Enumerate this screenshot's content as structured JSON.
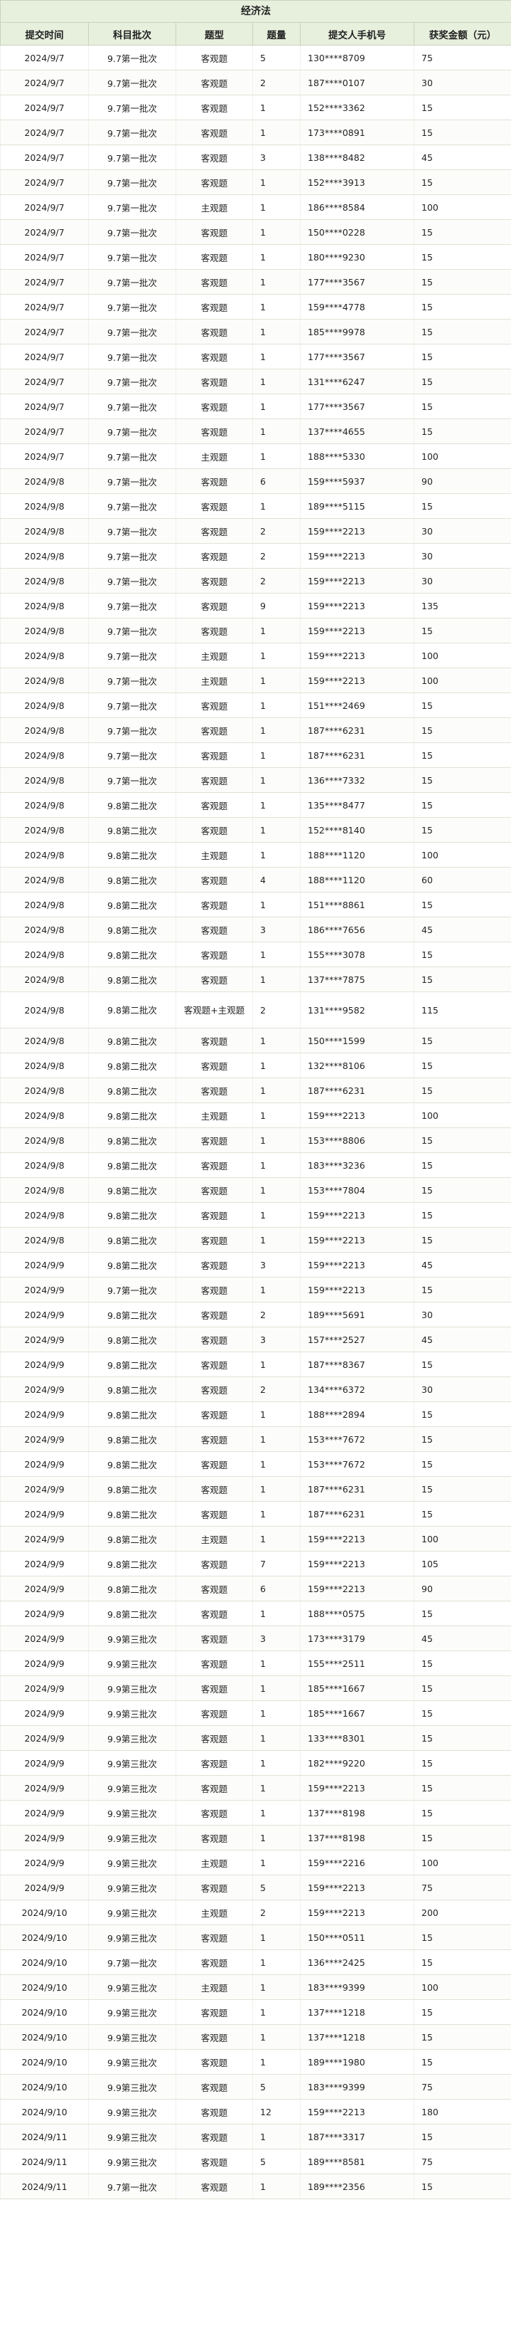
{
  "title": "经济法",
  "headers": [
    "提交时间",
    "科目批次",
    "题型",
    "题量",
    "提交人手机号",
    "获奖金额（元）"
  ],
  "rows": [
    [
      "2024/9/7",
      "9.7第一批次",
      "客观题",
      "5",
      "130****8709",
      "75"
    ],
    [
      "2024/9/7",
      "9.7第一批次",
      "客观题",
      "2",
      "187****0107",
      "30"
    ],
    [
      "2024/9/7",
      "9.7第一批次",
      "客观题",
      "1",
      "152****3362",
      "15"
    ],
    [
      "2024/9/7",
      "9.7第一批次",
      "客观题",
      "1",
      "173****0891",
      "15"
    ],
    [
      "2024/9/7",
      "9.7第一批次",
      "客观题",
      "3",
      "138****8482",
      "45"
    ],
    [
      "2024/9/7",
      "9.7第一批次",
      "客观题",
      "1",
      "152****3913",
      "15"
    ],
    [
      "2024/9/7",
      "9.7第一批次",
      "主观题",
      "1",
      "186****8584",
      "100"
    ],
    [
      "2024/9/7",
      "9.7第一批次",
      "客观题",
      "1",
      "150****0228",
      "15"
    ],
    [
      "2024/9/7",
      "9.7第一批次",
      "客观题",
      "1",
      "180****9230",
      "15"
    ],
    [
      "2024/9/7",
      "9.7第一批次",
      "客观题",
      "1",
      "177****3567",
      "15"
    ],
    [
      "2024/9/7",
      "9.7第一批次",
      "客观题",
      "1",
      "159****4778",
      "15"
    ],
    [
      "2024/9/7",
      "9.7第一批次",
      "客观题",
      "1",
      "185****9978",
      "15"
    ],
    [
      "2024/9/7",
      "9.7第一批次",
      "客观题",
      "1",
      "177****3567",
      "15"
    ],
    [
      "2024/9/7",
      "9.7第一批次",
      "客观题",
      "1",
      "131****6247",
      "15"
    ],
    [
      "2024/9/7",
      "9.7第一批次",
      "客观题",
      "1",
      "177****3567",
      "15"
    ],
    [
      "2024/9/7",
      "9.7第一批次",
      "客观题",
      "1",
      "137****4655",
      "15"
    ],
    [
      "2024/9/7",
      "9.7第一批次",
      "主观题",
      "1",
      "188****5330",
      "100"
    ],
    [
      "2024/9/8",
      "9.7第一批次",
      "客观题",
      "6",
      "159****5937",
      "90"
    ],
    [
      "2024/9/8",
      "9.7第一批次",
      "客观题",
      "1",
      "189****5115",
      "15"
    ],
    [
      "2024/9/8",
      "9.7第一批次",
      "客观题",
      "2",
      "159****2213",
      "30"
    ],
    [
      "2024/9/8",
      "9.7第一批次",
      "客观题",
      "2",
      "159****2213",
      "30"
    ],
    [
      "2024/9/8",
      "9.7第一批次",
      "客观题",
      "2",
      "159****2213",
      "30"
    ],
    [
      "2024/9/8",
      "9.7第一批次",
      "客观题",
      "9",
      "159****2213",
      "135"
    ],
    [
      "2024/9/8",
      "9.7第一批次",
      "客观题",
      "1",
      "159****2213",
      "15"
    ],
    [
      "2024/9/8",
      "9.7第一批次",
      "主观题",
      "1",
      "159****2213",
      "100"
    ],
    [
      "2024/9/8",
      "9.7第一批次",
      "主观题",
      "1",
      "159****2213",
      "100"
    ],
    [
      "2024/9/8",
      "9.7第一批次",
      "客观题",
      "1",
      "151****2469",
      "15"
    ],
    [
      "2024/9/8",
      "9.7第一批次",
      "客观题",
      "1",
      "187****6231",
      "15"
    ],
    [
      "2024/9/8",
      "9.7第一批次",
      "客观题",
      "1",
      "187****6231",
      "15"
    ],
    [
      "2024/9/8",
      "9.7第一批次",
      "客观题",
      "1",
      "136****7332",
      "15"
    ],
    [
      "2024/9/8",
      "9.8第二批次",
      "客观题",
      "1",
      "135****8477",
      "15"
    ],
    [
      "2024/9/8",
      "9.8第二批次",
      "客观题",
      "1",
      "152****8140",
      "15"
    ],
    [
      "2024/9/8",
      "9.8第二批次",
      "主观题",
      "1",
      "188****1120",
      "100"
    ],
    [
      "2024/9/8",
      "9.8第二批次",
      "客观题",
      "4",
      "188****1120",
      "60"
    ],
    [
      "2024/9/8",
      "9.8第二批次",
      "客观题",
      "1",
      "151****8861",
      "15"
    ],
    [
      "2024/9/8",
      "9.8第二批次",
      "客观题",
      "3",
      "186****7656",
      "45"
    ],
    [
      "2024/9/8",
      "9.8第二批次",
      "客观题",
      "1",
      "155****3078",
      "15"
    ],
    [
      "2024/9/8",
      "9.8第二批次",
      "客观题",
      "1",
      "137****7875",
      "15"
    ],
    [
      "2024/9/8",
      "9.8第二批次",
      "客观题+主观题",
      "2",
      "131****9582",
      "115"
    ],
    [
      "2024/9/8",
      "9.8第二批次",
      "客观题",
      "1",
      "150****1599",
      "15"
    ],
    [
      "2024/9/8",
      "9.8第二批次",
      "客观题",
      "1",
      "132****8106",
      "15"
    ],
    [
      "2024/9/8",
      "9.8第二批次",
      "客观题",
      "1",
      "187****6231",
      "15"
    ],
    [
      "2024/9/8",
      "9.8第二批次",
      "主观题",
      "1",
      "159****2213",
      "100"
    ],
    [
      "2024/9/8",
      "9.8第二批次",
      "客观题",
      "1",
      "153****8806",
      "15"
    ],
    [
      "2024/9/8",
      "9.8第二批次",
      "客观题",
      "1",
      "183****3236",
      "15"
    ],
    [
      "2024/9/8",
      "9.8第二批次",
      "客观题",
      "1",
      "153****7804",
      "15"
    ],
    [
      "2024/9/8",
      "9.8第二批次",
      "客观题",
      "1",
      "159****2213",
      "15"
    ],
    [
      "2024/9/8",
      "9.8第二批次",
      "客观题",
      "1",
      "159****2213",
      "15"
    ],
    [
      "2024/9/9",
      "9.8第二批次",
      "客观题",
      "3",
      "159****2213",
      "45"
    ],
    [
      "2024/9/9",
      "9.7第一批次",
      "客观题",
      "1",
      "159****2213",
      "15"
    ],
    [
      "2024/9/9",
      "9.8第二批次",
      "客观题",
      "2",
      "189****5691",
      "30"
    ],
    [
      "2024/9/9",
      "9.8第二批次",
      "客观题",
      "3",
      "157****2527",
      "45"
    ],
    [
      "2024/9/9",
      "9.8第二批次",
      "客观题",
      "1",
      "187****8367",
      "15"
    ],
    [
      "2024/9/9",
      "9.8第二批次",
      "客观题",
      "2",
      "134****6372",
      "30"
    ],
    [
      "2024/9/9",
      "9.8第二批次",
      "客观题",
      "1",
      "188****2894",
      "15"
    ],
    [
      "2024/9/9",
      "9.8第二批次",
      "客观题",
      "1",
      "153****7672",
      "15"
    ],
    [
      "2024/9/9",
      "9.8第二批次",
      "客观题",
      "1",
      "153****7672",
      "15"
    ],
    [
      "2024/9/9",
      "9.8第二批次",
      "客观题",
      "1",
      "187****6231",
      "15"
    ],
    [
      "2024/9/9",
      "9.8第二批次",
      "客观题",
      "1",
      "187****6231",
      "15"
    ],
    [
      "2024/9/9",
      "9.8第二批次",
      "主观题",
      "1",
      "159****2213",
      "100"
    ],
    [
      "2024/9/9",
      "9.8第二批次",
      "客观题",
      "7",
      "159****2213",
      "105"
    ],
    [
      "2024/9/9",
      "9.8第二批次",
      "客观题",
      "6",
      "159****2213",
      "90"
    ],
    [
      "2024/9/9",
      "9.8第二批次",
      "客观题",
      "1",
      "188****0575",
      "15"
    ],
    [
      "2024/9/9",
      "9.9第三批次",
      "客观题",
      "3",
      "173****3179",
      "45"
    ],
    [
      "2024/9/9",
      "9.9第三批次",
      "客观题",
      "1",
      "155****2511",
      "15"
    ],
    [
      "2024/9/9",
      "9.9第三批次",
      "客观题",
      "1",
      "185****1667",
      "15"
    ],
    [
      "2024/9/9",
      "9.9第三批次",
      "客观题",
      "1",
      "185****1667",
      "15"
    ],
    [
      "2024/9/9",
      "9.9第三批次",
      "客观题",
      "1",
      "133****8301",
      "15"
    ],
    [
      "2024/9/9",
      "9.9第三批次",
      "客观题",
      "1",
      "182****9220",
      "15"
    ],
    [
      "2024/9/9",
      "9.9第三批次",
      "客观题",
      "1",
      "159****2213",
      "15"
    ],
    [
      "2024/9/9",
      "9.9第三批次",
      "客观题",
      "1",
      "137****8198",
      "15"
    ],
    [
      "2024/9/9",
      "9.9第三批次",
      "客观题",
      "1",
      "137****8198",
      "15"
    ],
    [
      "2024/9/9",
      "9.9第三批次",
      "主观题",
      "1",
      "159****2216",
      "100"
    ],
    [
      "2024/9/9",
      "9.9第三批次",
      "客观题",
      "5",
      "159****2213",
      "75"
    ],
    [
      "2024/9/10",
      "9.9第三批次",
      "主观题",
      "2",
      "159****2213",
      "200"
    ],
    [
      "2024/9/10",
      "9.9第三批次",
      "客观题",
      "1",
      "150****0511",
      "15"
    ],
    [
      "2024/9/10",
      "9.7第一批次",
      "客观题",
      "1",
      "136****2425",
      "15"
    ],
    [
      "2024/9/10",
      "9.9第三批次",
      "主观题",
      "1",
      "183****9399",
      "100"
    ],
    [
      "2024/9/10",
      "9.9第三批次",
      "客观题",
      "1",
      "137****1218",
      "15"
    ],
    [
      "2024/9/10",
      "9.9第三批次",
      "客观题",
      "1",
      "137****1218",
      "15"
    ],
    [
      "2024/9/10",
      "9.9第三批次",
      "客观题",
      "1",
      "189****1980",
      "15"
    ],
    [
      "2024/9/10",
      "9.9第三批次",
      "客观题",
      "5",
      "183****9399",
      "75"
    ],
    [
      "2024/9/10",
      "9.9第三批次",
      "客观题",
      "12",
      "159****2213",
      "180"
    ],
    [
      "2024/9/11",
      "9.9第三批次",
      "客观题",
      "1",
      "187****3317",
      "15"
    ],
    [
      "2024/9/11",
      "9.9第三批次",
      "客观题",
      "5",
      "189****8581",
      "75"
    ],
    [
      "2024/9/11",
      "9.7第一批次",
      "客观题",
      "1",
      "189****2356",
      "15"
    ]
  ]
}
